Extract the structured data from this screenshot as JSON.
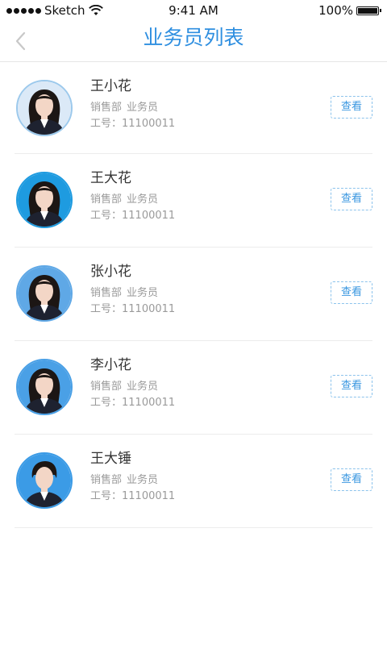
{
  "status_bar": {
    "carrier": "Sketch",
    "time": "9:41 AM",
    "battery": "100%",
    "battery_level": 1.0
  },
  "nav": {
    "title": "业务员列表"
  },
  "salespeople": [
    {
      "name": "王小花",
      "department": "销售部",
      "role": "业务员",
      "employee_no": "工号：11100011",
      "view_label": "查看",
      "avatar_bg": "#dbe9f7",
      "avatar_border": "#9cc9ec"
    },
    {
      "name": "王大花",
      "department": "销售部",
      "role": "业务员",
      "employee_no": "工号：11100011",
      "view_label": "查看",
      "avatar_bg": "#1e9be0",
      "avatar_border": "#1e9be0"
    },
    {
      "name": "张小花",
      "department": "销售部",
      "role": "业务员",
      "employee_no": "工号：11100011",
      "view_label": "查看",
      "avatar_bg": "#5fa8e6",
      "avatar_border": "#5fa8e6"
    },
    {
      "name": "李小花",
      "department": "销售部",
      "role": "业务员",
      "employee_no": "工号：11100011",
      "view_label": "查看",
      "avatar_bg": "#4aa0e6",
      "avatar_border": "#4aa0e6"
    },
    {
      "name": "王大锤",
      "department": "销售部",
      "role": "业务员",
      "employee_no": "工号：11100011",
      "view_label": "查看",
      "avatar_bg": "#3b9be6",
      "avatar_border": "#3b9be6"
    }
  ],
  "colors": {
    "accent": "#2f8fe0",
    "secondary_text": "#9a9a9a",
    "button_border": "#8cc3ec"
  }
}
